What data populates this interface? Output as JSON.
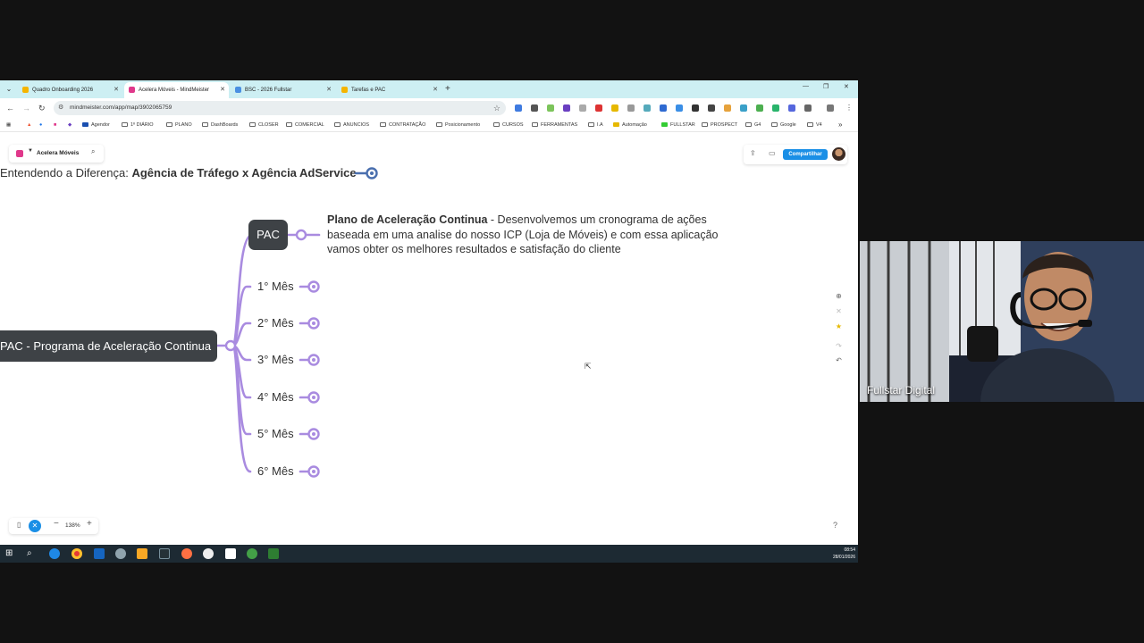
{
  "browser": {
    "tabs": [
      {
        "label": "Quadro Onboarding 2026"
      },
      {
        "label": "Acelera Móveis - MindMeister"
      },
      {
        "label": "BSC - 2026 Fullstar"
      },
      {
        "label": "Tarefas e PAC"
      }
    ],
    "url": "mindmeister.com/app/map/3902065759",
    "bookmarks": [
      "Agendor",
      "1º DIÁRIO",
      "PLANO",
      "DashBoards",
      "CLOSER",
      "COMERCIAL",
      "ANUNCIOS",
      "CONTRATAÇÃO",
      "Posicionamento",
      "CURSOS",
      "FERRAMENTAS",
      "I.A",
      "Automação",
      "FULLSTAR",
      "PROSPECT",
      "G4",
      "Google",
      "V4"
    ]
  },
  "app": {
    "map_name": "Acelera Móveis",
    "share_label": "Compartilhar",
    "zoom_level": "138%"
  },
  "map": {
    "title_prefix": "Entendendo a Diferença:",
    "title_bold": "Agência de Tráfego x Agência AdService",
    "root": "PAC - Programa de Aceleração Continua",
    "pac": "PAC",
    "note_bold": "Plano de Aceleração Continua",
    "note_text": " - Desenvolvemos um cronograma de ações baseada em uma analise do nosso ICP (Loja de Móveis) e com essa aplicação vamos obter os melhores resultados e satisfação do cliente",
    "months": [
      "1° Mês",
      "2° Mês",
      "3° Mês",
      "4° Mês",
      "5° Mês",
      "6° Mês"
    ]
  },
  "taskbar": {
    "time": "08:54",
    "date": "28/01/2026"
  },
  "webcam": {
    "name": "Fullstar Digital"
  },
  "colors": {
    "branch": "#a98be0",
    "node_dark": "#3e4246",
    "accent_blue": "#1a8fe6",
    "tabstrip": "#cdeff3"
  }
}
